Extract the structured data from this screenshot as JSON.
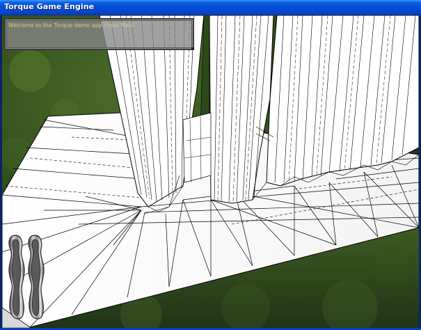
{
  "window": {
    "title": "Torque Game Engine"
  },
  "hud": {
    "chat_message": "Welcome to the Torque demo app Fresh Meat",
    "gauges": [
      {
        "name": "health-gauge",
        "level": 0
      },
      {
        "name": "energy-gauge",
        "level": 0
      }
    ]
  },
  "colors": {
    "titlebar": "#0551de",
    "chat_text": "#d8c98a",
    "hud_panel": "#878787",
    "wireframe": "#000000",
    "surface": "#ffffff",
    "grass": "#2f4a1c"
  }
}
